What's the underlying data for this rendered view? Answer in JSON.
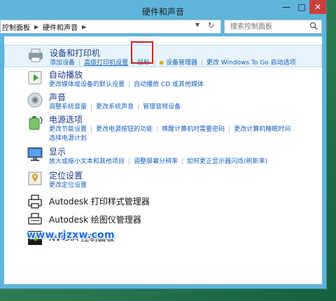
{
  "window": {
    "title": "硬件和声音",
    "min": "—",
    "max": "□",
    "close": "✕"
  },
  "address": {
    "crumbs": [
      "控制面板",
      "硬件和声音"
    ],
    "search_placeholder": "搜索控制面板"
  },
  "categories": [
    {
      "title": "设备和打印机",
      "links": [
        "添加设备",
        "高级打印机设置",
        "鼠标",
        "设备管理器",
        "更改 Windows To Go 启动选项"
      ]
    },
    {
      "title": "自动播放",
      "links": [
        "更改媒体或设备的默认设置",
        "自动播放 CD 或其他媒体"
      ]
    },
    {
      "title": "声音",
      "links": [
        "调整系统音量",
        "更改系统声音",
        "管理音频设备"
      ]
    },
    {
      "title": "电源选项",
      "links": [
        "更改节能设置",
        "更改电源按钮的功能",
        "唤醒计算机时需要密码",
        "更改计算机睡眠时间"
      ],
      "links2": [
        "选择电源计划"
      ]
    },
    {
      "title": "显示",
      "links": [
        "放大或缩小文本和其他项目",
        "调整屏幕分辨率",
        "如何更正显示器闪烁(刷新率)"
      ]
    },
    {
      "title": "定位设置",
      "links": [
        "更改定位设置"
      ]
    }
  ],
  "extras": [
    {
      "title": "Autodesk 打印样式管理器"
    },
    {
      "title": "Autodesk 绘图仪管理器"
    },
    {
      "title": "NVIDIA 控制面板"
    }
  ],
  "watermark": "www.rjzxw.com"
}
